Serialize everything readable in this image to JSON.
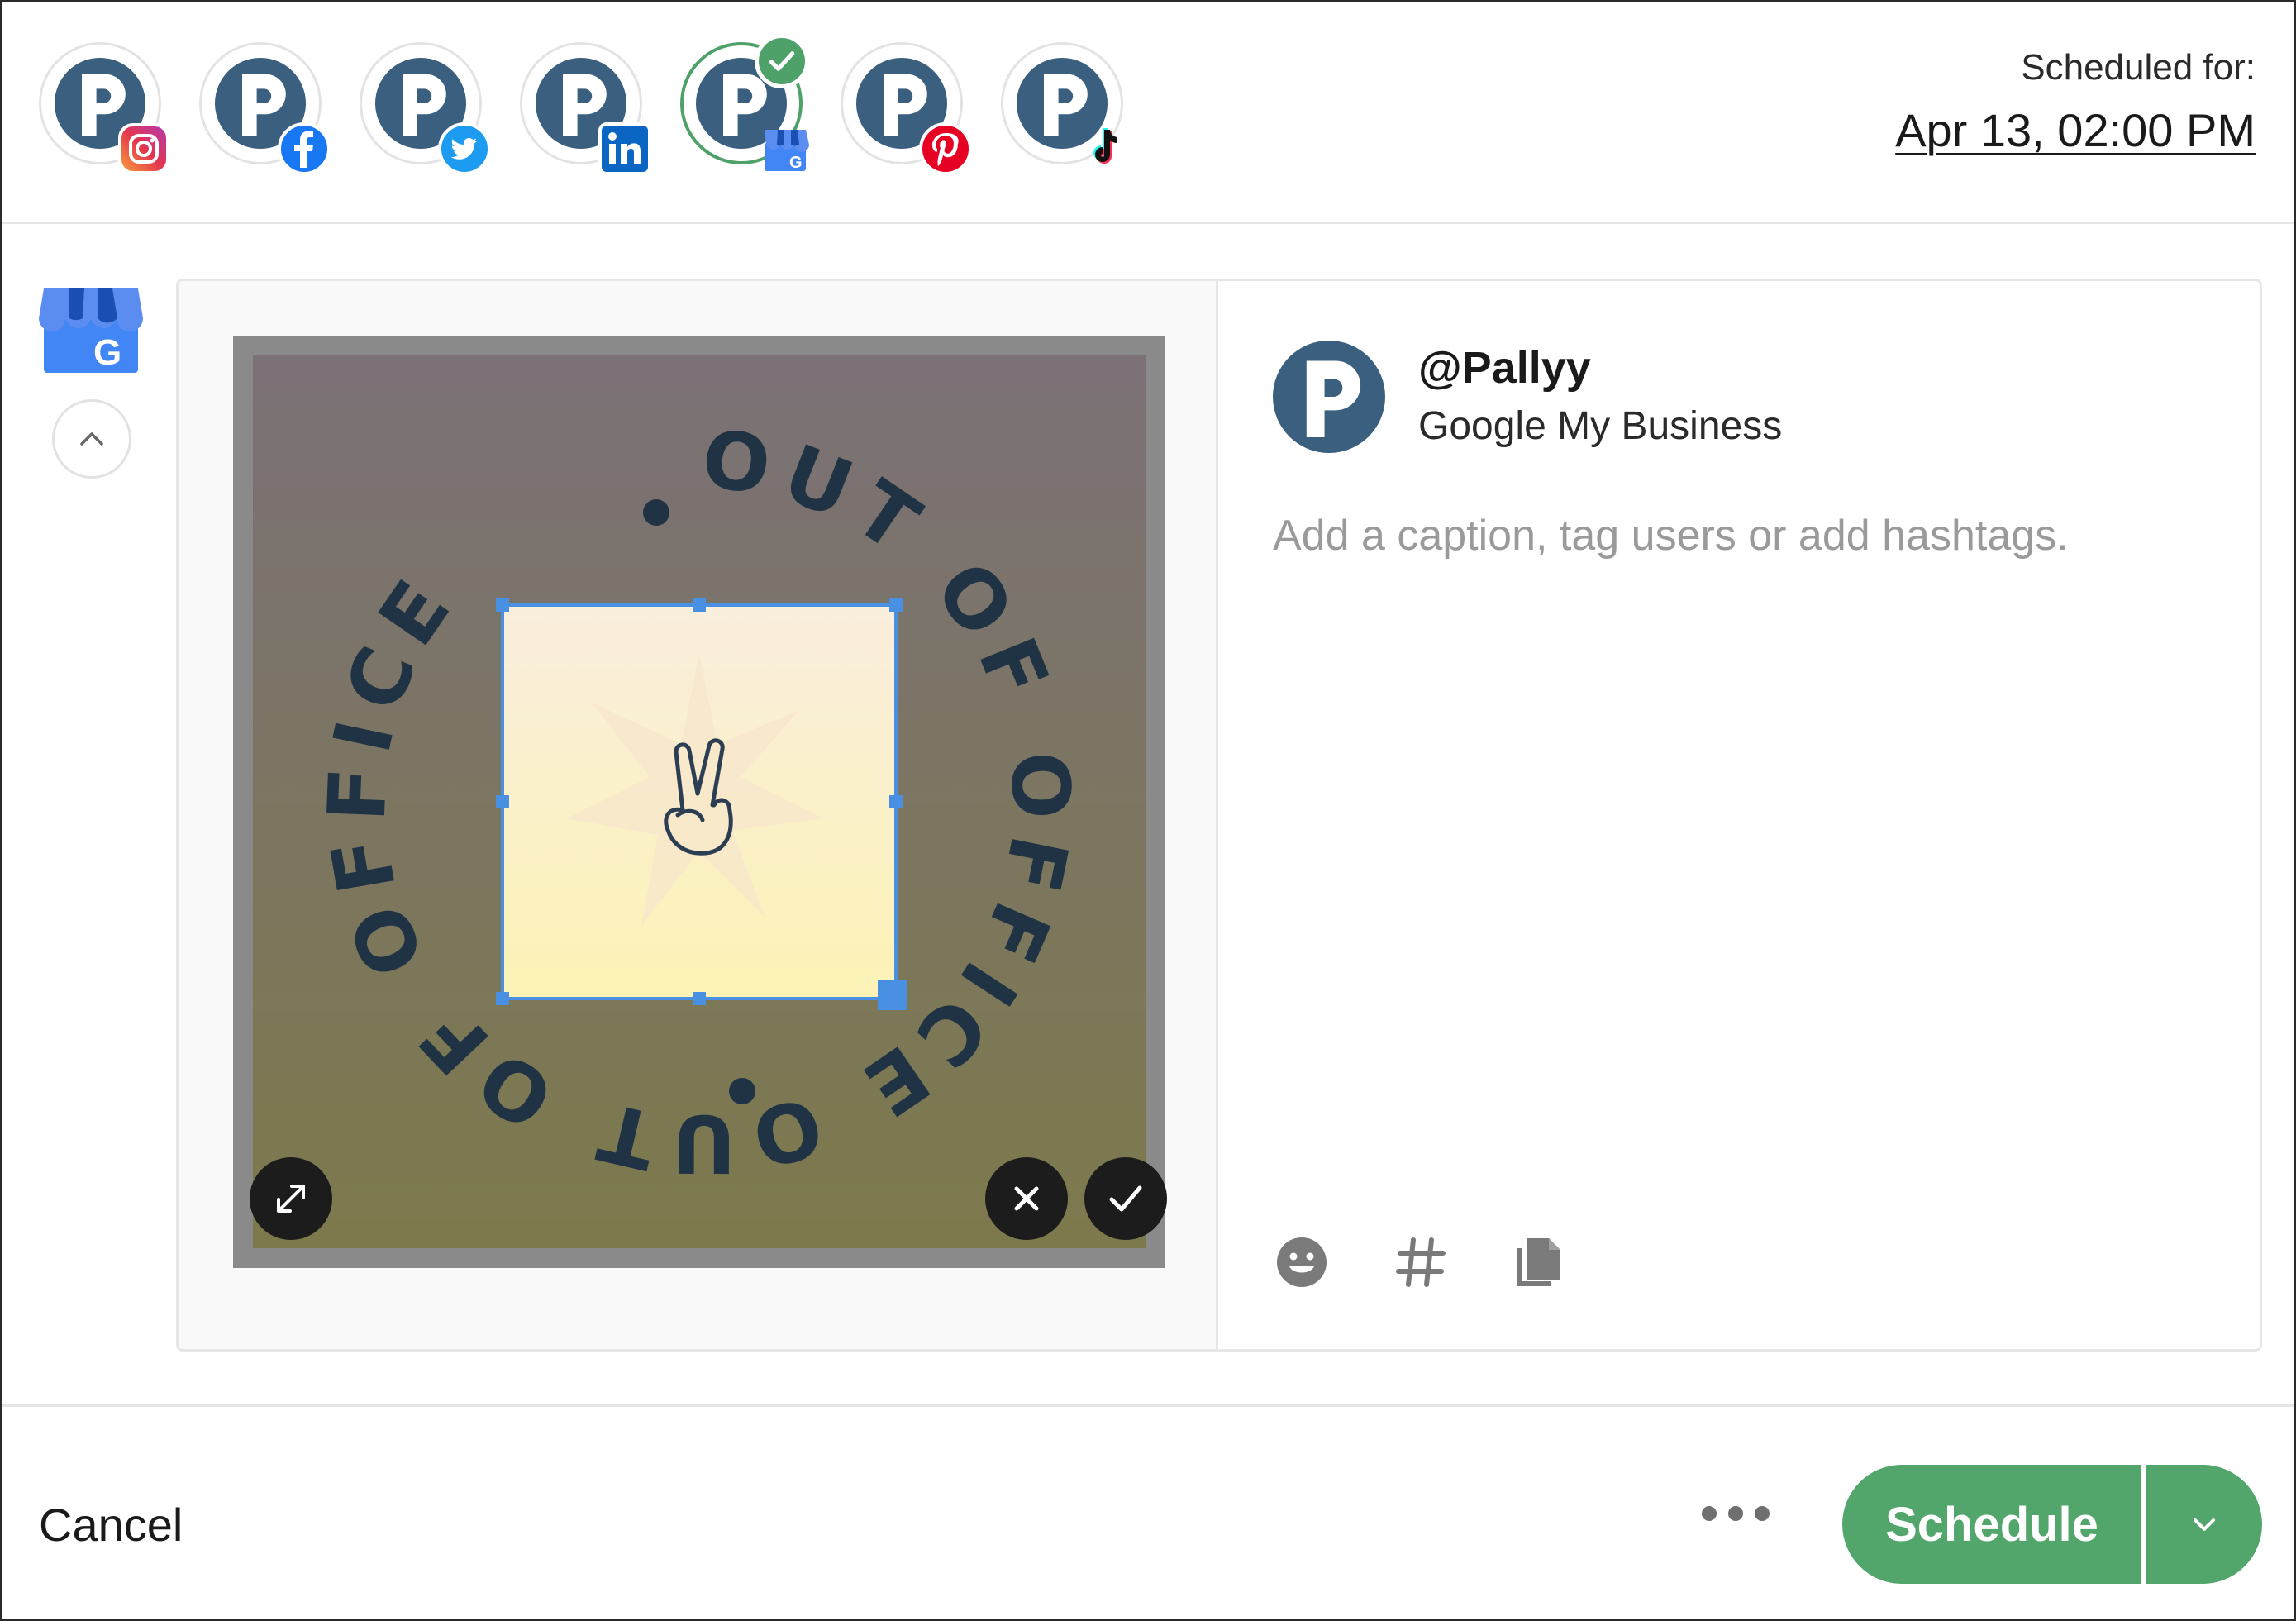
{
  "header": {
    "accounts": [
      {
        "network": "instagram",
        "badge_icon": "instagram-icon",
        "selected": false
      },
      {
        "network": "facebook",
        "badge_icon": "facebook-icon",
        "selected": false
      },
      {
        "network": "twitter",
        "badge_icon": "twitter-icon",
        "selected": false
      },
      {
        "network": "linkedin",
        "badge_icon": "linkedin-icon",
        "selected": false
      },
      {
        "network": "google-my-business",
        "badge_icon": "google-my-business-icon",
        "selected": true
      },
      {
        "network": "pinterest",
        "badge_icon": "pinterest-icon",
        "selected": false
      },
      {
        "network": "tiktok",
        "badge_icon": "tiktok-icon",
        "selected": false
      }
    ],
    "scheduled_label": "Scheduled for:",
    "scheduled_date": "Apr 13, 02:00 PM"
  },
  "editor": {
    "image_text": "OUT OF OFFICE",
    "handle": "@Pallyy",
    "network_name": "Google My Business",
    "caption_placeholder": "Add a caption, tag users or add hashtags.",
    "caption_value": "",
    "tools": [
      "emoji-icon",
      "hashtag-icon",
      "copy-icon"
    ]
  },
  "footer": {
    "cancel_label": "Cancel",
    "schedule_label": "Schedule"
  },
  "colors": {
    "accent_green": "#52a56b",
    "brand_blue": "#3b5f7f",
    "crop_blue": "#4a90e2"
  }
}
